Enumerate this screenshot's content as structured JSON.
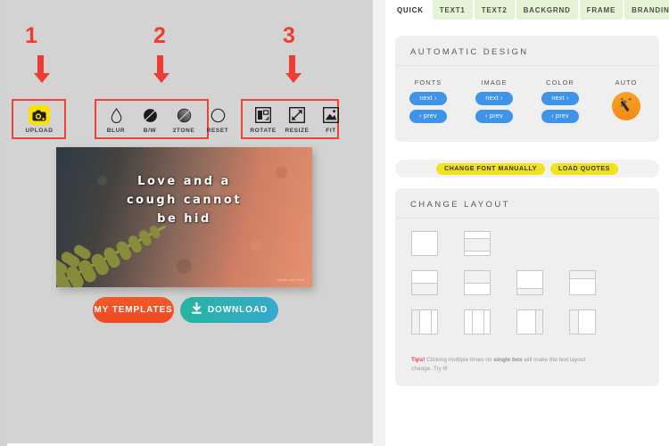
{
  "annotations": [
    {
      "number": "1",
      "target": "upload-tool"
    },
    {
      "number": "2",
      "target": "filter-tools"
    },
    {
      "number": "3",
      "target": "transform-tools"
    }
  ],
  "editor": {
    "upload": {
      "label": "UPLOAD",
      "icon": "camera-icon",
      "badge_color": "#ffe100"
    },
    "filters": [
      {
        "label": "BLUR",
        "icon": "water-drop-icon"
      },
      {
        "label": "B/W",
        "icon": "half-filled-circle-icon"
      },
      {
        "label": "2TONE",
        "icon": "gradient-circle-icon"
      },
      {
        "label": "RESET",
        "icon": "empty-circle-icon"
      }
    ],
    "transforms": [
      {
        "label": "ROTATE",
        "icon": "rotate-icon"
      },
      {
        "label": "RESIZE",
        "icon": "resize-icon"
      },
      {
        "label": "FIT",
        "icon": "fit-image-icon"
      }
    ],
    "preview": {
      "quote_lines": [
        "Love and a",
        "cough cannot",
        "be hid"
      ],
      "watermark": "Made with love",
      "background_colors": [
        "#2e3a46",
        "#8e6a5c",
        "#e79272"
      ]
    },
    "actions": {
      "templates_label": "MY TEMPLATES",
      "templates_color": "#f05a28",
      "download_label": "DOWNLOAD",
      "download_icon": "download-icon",
      "download_color": "#27b4a0"
    }
  },
  "sidebar": {
    "tabs": [
      {
        "label": "QUICK",
        "active": true
      },
      {
        "label": "TEXT1",
        "active": false
      },
      {
        "label": "TEXT2",
        "active": false
      },
      {
        "label": "BACKGRND",
        "active": false
      },
      {
        "label": "FRAME",
        "active": false
      },
      {
        "label": "BRANDING",
        "active": false
      }
    ],
    "highlight_color": "#f2ef1b",
    "automatic_design": {
      "title": "AUTOMATIC DESIGN",
      "columns": [
        {
          "label": "FONTS",
          "next": "next ›",
          "prev": "‹ prev"
        },
        {
          "label": "IMAGE",
          "next": "next ›",
          "prev": "‹ prev"
        },
        {
          "label": "COLOR",
          "next": "next ›",
          "prev": "‹ prev"
        }
      ],
      "auto": {
        "label": "AUTO",
        "icon": "magic-wand-icon",
        "color": "#f59c1a"
      }
    },
    "quick_actions": {
      "change_font_label": "CHANGE FONT MANUALLY",
      "load_quotes_label": "LOAD QUOTES",
      "pill_color": "#f2e21c"
    },
    "change_layout": {
      "title": "CHANGE LAYOUT",
      "tip_prefix": "Tips!",
      "tip_text_1": " Clicking multiple times on ",
      "tip_emphasis": "single box",
      "tip_text_2": " will make the text layout change. Try it!"
    }
  }
}
